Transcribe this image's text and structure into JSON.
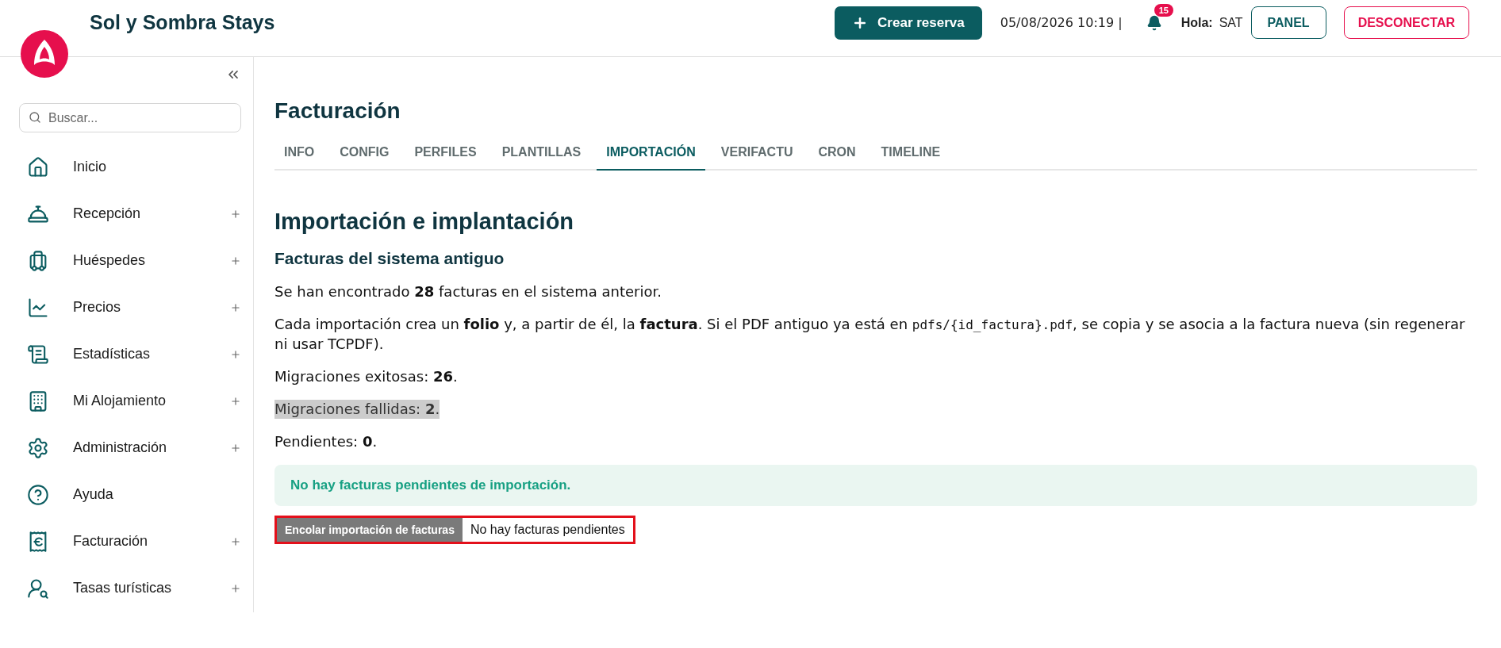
{
  "header": {
    "brand": "Sol y Sombra Stays",
    "create_button": "Crear reserva",
    "datetime": "05/08/2026 10:19 |",
    "notifications": "15",
    "greeting_label": "Hola:",
    "user": "SAT",
    "panel_button": "PANEL",
    "logout_button": "DESCONECTAR"
  },
  "sidebar": {
    "search": {
      "placeholder": "Buscar..."
    },
    "items": [
      {
        "label": "Inicio",
        "expandable": false
      },
      {
        "label": "Recepción",
        "expandable": true
      },
      {
        "label": "Huéspedes",
        "expandable": true
      },
      {
        "label": "Precios",
        "expandable": true
      },
      {
        "label": "Estadísticas",
        "expandable": true
      },
      {
        "label": "Mi Alojamiento",
        "expandable": true
      },
      {
        "label": "Administración",
        "expandable": true
      },
      {
        "label": "Ayuda",
        "expandable": false
      },
      {
        "label": "Facturación",
        "expandable": true
      },
      {
        "label": "Tasas turísticas",
        "expandable": true
      }
    ]
  },
  "page": {
    "title": "Facturación",
    "tabs": [
      {
        "label": "INFO",
        "selected": false
      },
      {
        "label": "CONFIG",
        "selected": false
      },
      {
        "label": "PERFILES",
        "selected": false
      },
      {
        "label": "PLANTILLAS",
        "selected": false
      },
      {
        "label": "IMPORTACIÓN",
        "selected": true
      },
      {
        "label": "VERIFACTU",
        "selected": false
      },
      {
        "label": "CRON",
        "selected": false
      },
      {
        "label": "TIMELINE",
        "selected": false
      }
    ],
    "heading": "Importación e implantación",
    "subheading": "Facturas del sistema antiguo",
    "found_text": "Se han encontrado **28** facturas en el sistema anterior.",
    "description": {
      "before": "Cada importación crea un **folio** y, a partir de él, la **factura**. Si el PDF antiguo ya está en",
      "code": "pdfs/{id_factura}.pdf",
      "after": ", se copia y se asocia a la factura nueva (sin regenerar ni usar TCPDF)."
    },
    "stats": [
      {
        "text": "Migraciones exitosas: **26**.",
        "highlighted": false
      },
      {
        "text": "Migraciones fallidas: **2**.",
        "highlighted": true
      },
      {
        "text": "Pendientes: **0**.",
        "highlighted": false
      }
    ],
    "notice": "No hay facturas pendientes de importación.",
    "queue_button": {
      "label": "Encolar importación de facturas",
      "disabled": true
    },
    "queue_status": "No hay facturas pendientes"
  }
}
